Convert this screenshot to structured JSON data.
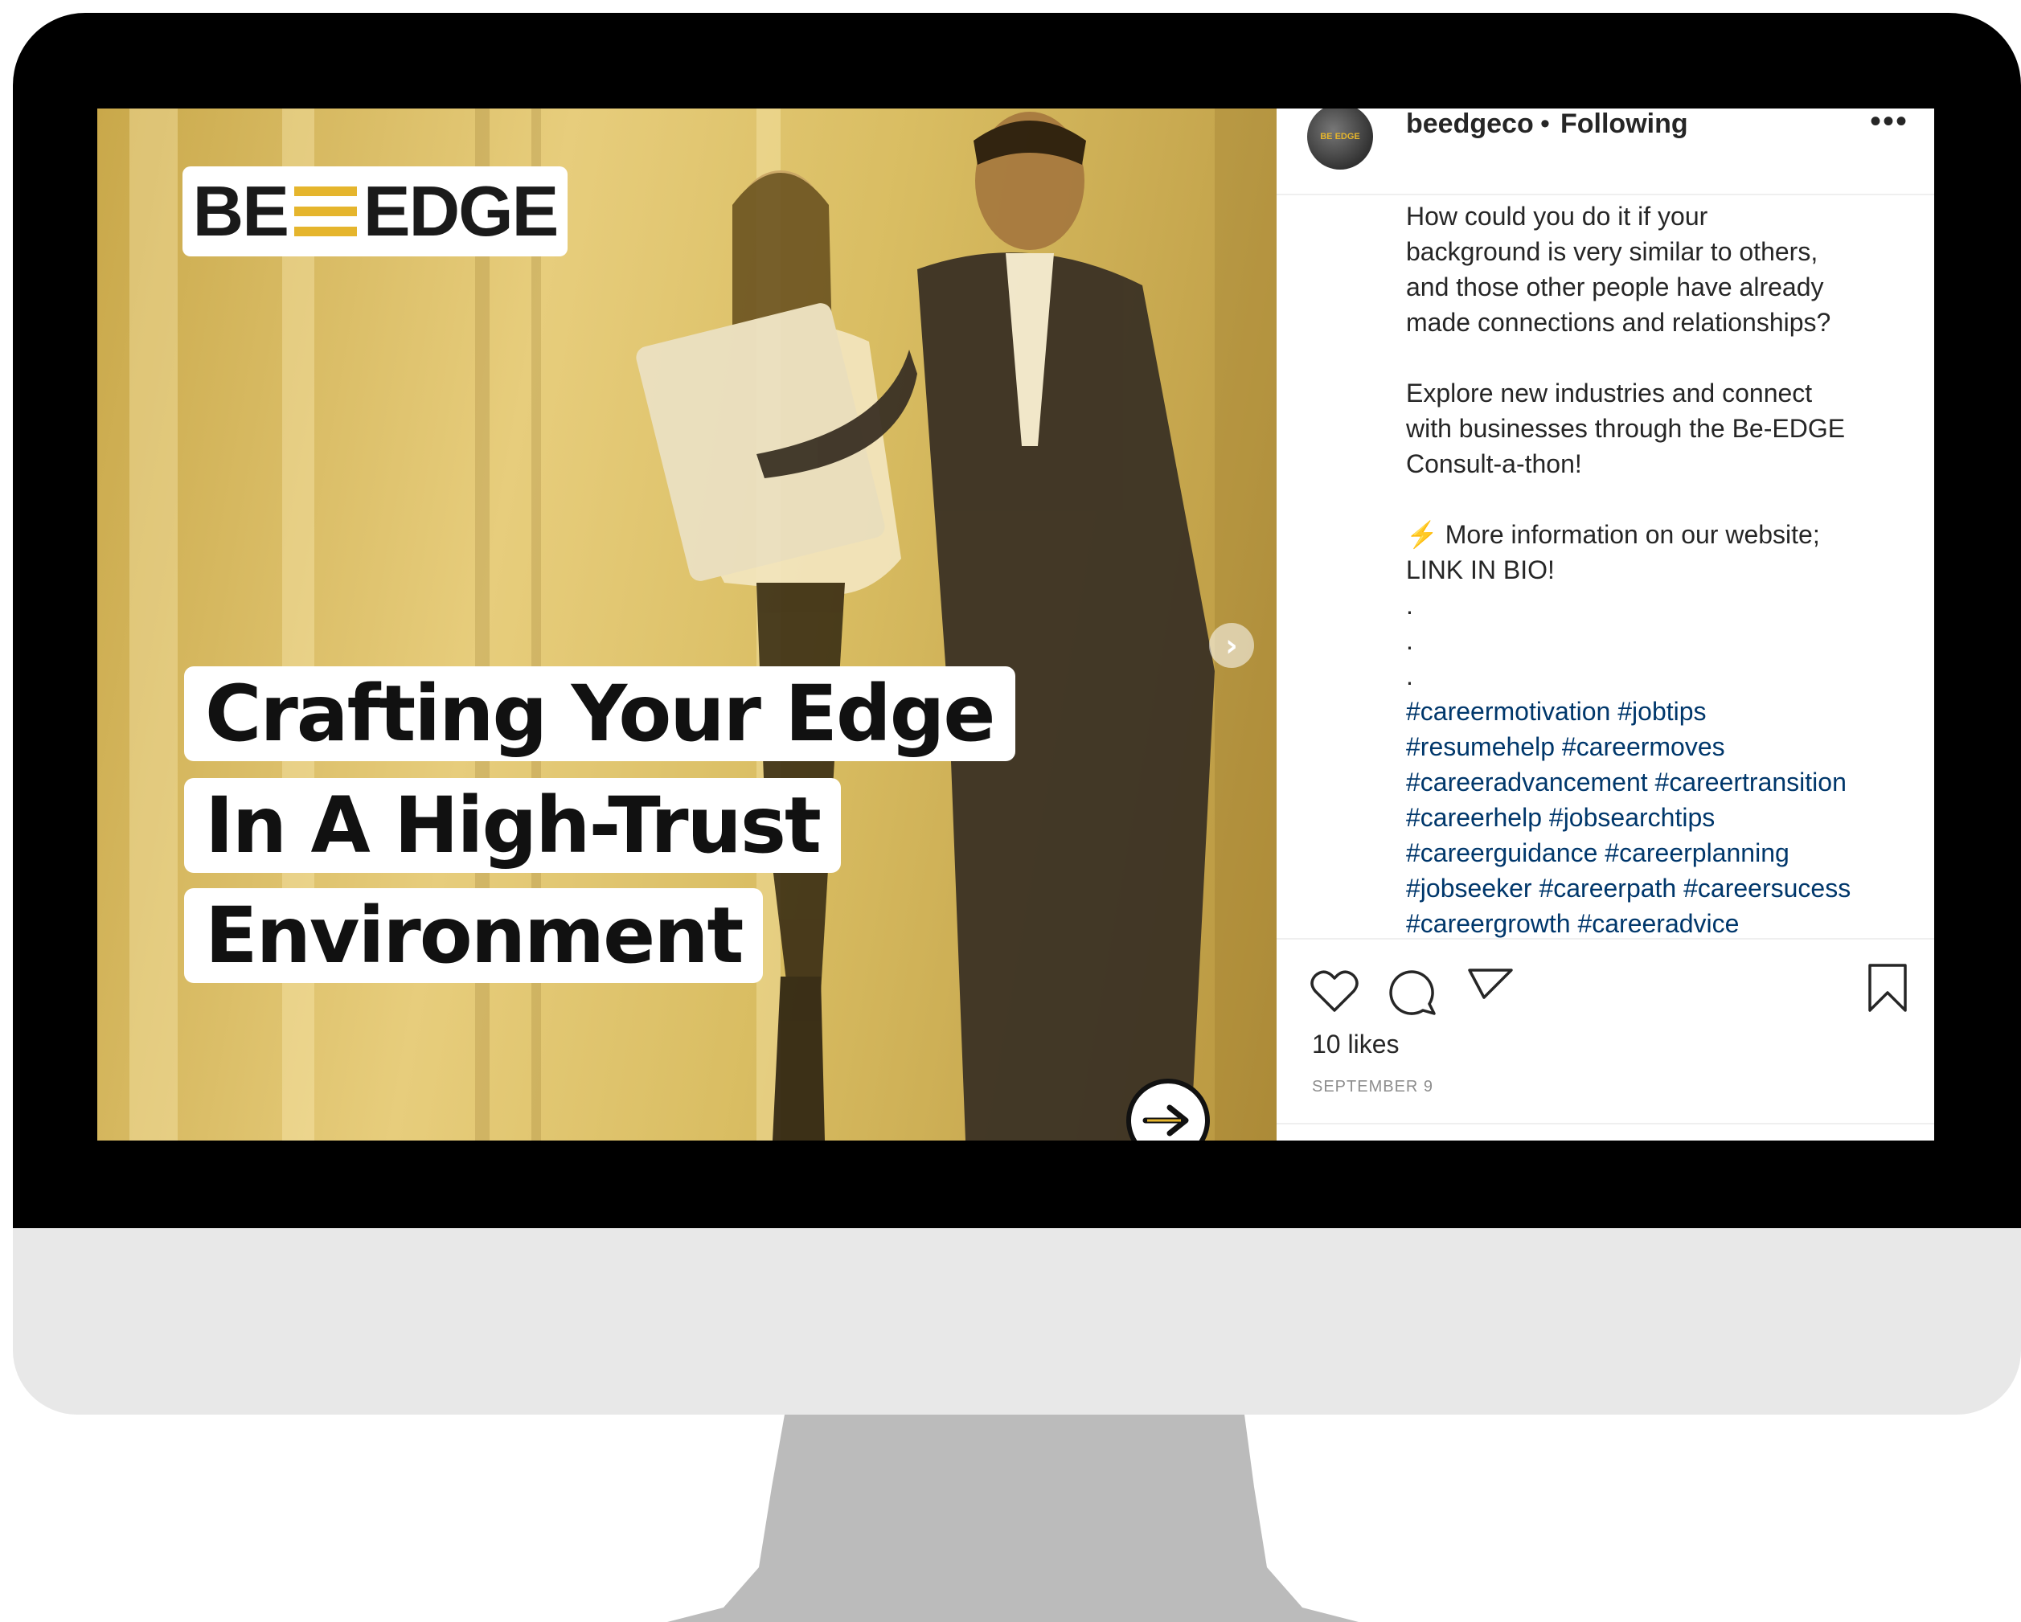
{
  "post": {
    "logo": {
      "left_text": "BE",
      "right_text": "EDGE"
    },
    "headline": [
      "Crafting Your Edge",
      "In A High-Trust",
      "Environment"
    ]
  },
  "panel": {
    "username": "beedgeco",
    "separator": "•",
    "follow_status": "Following",
    "more_label": "•••",
    "avatar_text": "BE EDGE",
    "caption": {
      "p1": [
        "How could you do it if your",
        "background is very similar to others,",
        "and those other people have already",
        "made connections and relationships?"
      ],
      "p2": [
        "Explore new industries and connect",
        "with businesses through the Be-EDGE",
        "Consult-a-thon!"
      ],
      "p3": [
        "⚡ More information on our website;",
        "LINK IN BIO!"
      ],
      "dots": [
        ".",
        ".",
        "."
      ],
      "hashtags": [
        "#careermotivation #jobtips",
        "#resumehelp #careermoves",
        "#careeradvancement #careertransition",
        "#careerhelp #jobsearchtips",
        "#careerguidance #careerplanning",
        "#jobseeker #careerpath #careersucess",
        "#careergrowth #careeradvice"
      ]
    },
    "likes": "10 likes",
    "date": "SEPTEMBER 9"
  },
  "colors": {
    "accent": "#e5b52d",
    "hashtag": "#00376b",
    "text": "#262626",
    "muted": "#8e8e8e"
  }
}
